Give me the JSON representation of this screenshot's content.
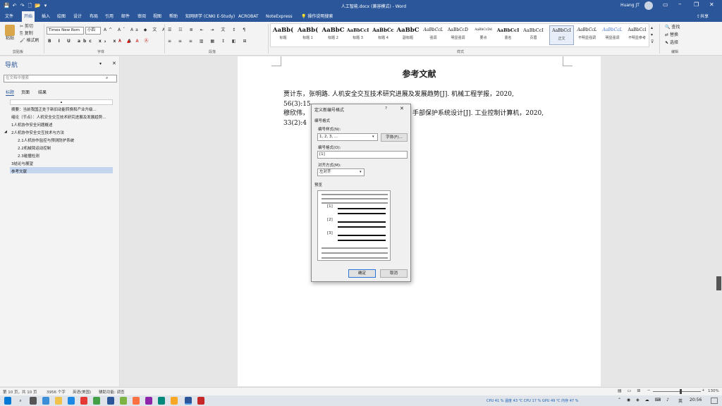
{
  "window": {
    "title": "人工智能.docx (兼容模式) - Word",
    "user": "Huang JT"
  },
  "menu": {
    "tabs": [
      "文件",
      "开始",
      "插入",
      "绘图",
      "设计",
      "布局",
      "引用",
      "邮件",
      "审阅",
      "视图",
      "帮助",
      "知网研学 (CNKI E-Study)",
      "ACROBAT",
      "NoteExpress"
    ],
    "tell_me": "操作说明搜索",
    "share": "共享",
    "active_tab": "开始"
  },
  "ribbon": {
    "clipboard": {
      "paste": "粘贴",
      "cut": "剪切",
      "copy": "复制",
      "format_painter": "格式刷",
      "group": "剪贴板"
    },
    "font": {
      "family": "Times New Rom",
      "size": "小四",
      "group": "字体"
    },
    "paragraph": {
      "group": "段落"
    },
    "styles": {
      "group": "样式",
      "items": [
        {
          "preview": "AaBb(",
          "name": "标题"
        },
        {
          "preview": "AaBb(",
          "name": "标题 1"
        },
        {
          "preview": "AaBbC",
          "name": "标题 2"
        },
        {
          "preview": "AaBbCcI",
          "name": "标题 3"
        },
        {
          "preview": "AaBbCc",
          "name": "标题 4"
        },
        {
          "preview": "AaBbC",
          "name": "副标题"
        },
        {
          "preview": "AaBbCcL",
          "name": "强调"
        },
        {
          "preview": "AaBbCcD",
          "name": "明显强调"
        },
        {
          "preview": "AaBbCcDd",
          "name": "要点"
        },
        {
          "preview": "AaBbCcI",
          "name": "書名"
        },
        {
          "preview": "AaBbCcI",
          "name": "页眉"
        },
        {
          "preview": "AaBbCcI",
          "name": "正文"
        },
        {
          "preview": "AaBbCcL",
          "name": "不明显强调"
        },
        {
          "preview": "AaBbCcL",
          "name": "明显强调"
        },
        {
          "preview": "AaBbCcl",
          "name": "不明显参考"
        }
      ]
    },
    "editing": {
      "find": "查找",
      "replace": "替换",
      "select": "选择",
      "group": "编辑"
    }
  },
  "nav": {
    "title": "导航",
    "search_placeholder": "在文档中搜索",
    "tabs": [
      "标题",
      "页面",
      "结果"
    ],
    "items": [
      "摘要：当前我国正处于新旧动能转换和产业升级...",
      "绪论（节点）：人机安全交互技术研究进展及发展趋势...",
      "1人机协作安全问题概述",
      "2人机协作安全交互技术与方法",
      "2.1人机协作监控与预测防护系统",
      "2.2机械臂运动控制",
      "2.3碰撞检测",
      "3结论与展望",
      "参考文献"
    ],
    "selected_index": 8
  },
  "document": {
    "heading": "参考文献",
    "refs": [
      "贾计东，张明路. 人机安全交互技术研究进展及发展趋势[J]. 机械工程学报，2020,",
      "56(3):15",
      "穆欣伟，",
      "手部保护系统设计[J]. 工业控制计算机，2020,",
      "33(2):4"
    ]
  },
  "dialog": {
    "title": "定义新编号格式",
    "help": "?",
    "close": "✕",
    "section_format": "编号格式",
    "style_label": "编号样式(N):",
    "style_value": "1, 2, 3, ...",
    "font_button": "字体(F)...",
    "format_label": "编号格式(O):",
    "format_value": "[1]",
    "align_label": "对齐方式(M):",
    "align_value": "左对齐",
    "preview_label": "预览",
    "preview_items": [
      "[1]",
      "[2]",
      "[3]"
    ],
    "ok": "确定",
    "cancel": "取消"
  },
  "status": {
    "page": "第 10 页，共 10 页",
    "words": "3956 个字",
    "lang": "英语(美国)",
    "accessibility": "辅助功能: 调查",
    "zoom": "130%"
  },
  "taskbar": {
    "weather": "CPU 41 % 温度 43 ℃ CPU 17 % GPU 49 ℃ 内存 47 %",
    "lang": "英",
    "time": "20:56"
  },
  "colors": {
    "accent": "#2b579a",
    "nav_selected": "#c5d5ee"
  }
}
